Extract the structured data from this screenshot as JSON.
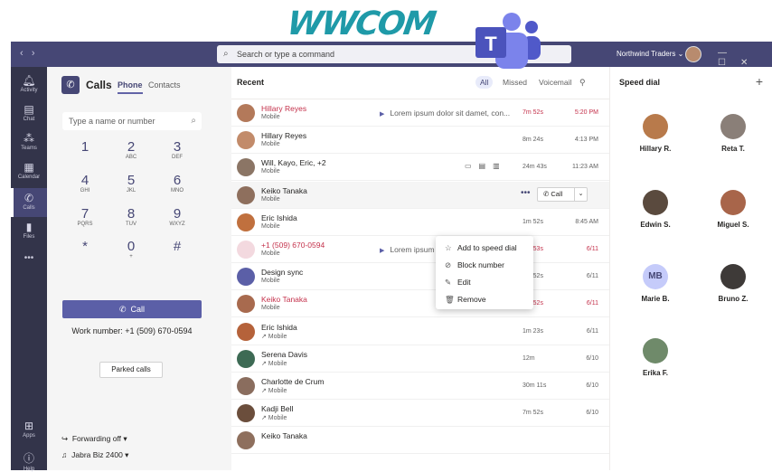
{
  "branding": {
    "wwcom": "WWCOM",
    "teams_letter": "T"
  },
  "titlebar": {
    "search_placeholder": "Search or type a command",
    "org": "Northwind Traders ⌄"
  },
  "rail": [
    {
      "label": "Activity",
      "icon": "bell-icon"
    },
    {
      "label": "Chat",
      "icon": "chat-icon"
    },
    {
      "label": "Teams",
      "icon": "teams-icon"
    },
    {
      "label": "Calendar",
      "icon": "calendar-icon"
    },
    {
      "label": "Calls",
      "icon": "phone-icon"
    },
    {
      "label": "Files",
      "icon": "file-icon"
    },
    {
      "label": "•••",
      "icon": "more-icon"
    },
    {
      "label": "Apps",
      "icon": "apps-icon"
    },
    {
      "label": "Help",
      "icon": "help-icon"
    }
  ],
  "calls": {
    "title": "Calls",
    "tabs": [
      "Phone",
      "Contacts"
    ],
    "number_placeholder": "Type a name or number",
    "keys": [
      {
        "d": "1",
        "l": ""
      },
      {
        "d": "2",
        "l": "ABC"
      },
      {
        "d": "3",
        "l": "DEF"
      },
      {
        "d": "4",
        "l": "GHI"
      },
      {
        "d": "5",
        "l": "JKL"
      },
      {
        "d": "6",
        "l": "MNO"
      },
      {
        "d": "7",
        "l": "PQRS"
      },
      {
        "d": "8",
        "l": "TUV"
      },
      {
        "d": "9",
        "l": "WXYZ"
      },
      {
        "d": "*",
        "l": ""
      },
      {
        "d": "0",
        "l": "+"
      },
      {
        "d": "#",
        "l": ""
      }
    ],
    "call_label": "Call",
    "work_number": "Work number: +1 (509) 670-0594",
    "parked": "Parked calls",
    "forwarding": "Forwarding off ▾",
    "device": "Jabra Biz 2400 ▾"
  },
  "recent": {
    "title": "Recent",
    "filters": [
      "All",
      "Missed",
      "Voicemail"
    ],
    "rows": [
      {
        "name": "Hillary Reyes",
        "type": "Mobile",
        "missed": true,
        "vm": "Lorem ipsum dolor sit damet, con...",
        "dur": "7m 52s",
        "time": "5:20 PM"
      },
      {
        "name": "Hillary Reyes",
        "type": "Mobile",
        "missed": false,
        "vm": "",
        "dur": "8m 24s",
        "time": "4:13 PM"
      },
      {
        "name": "Will, Kayo, Eric, +2",
        "type": "Mobile",
        "missed": false,
        "vm": "",
        "dur": "24m 43s",
        "time": "11:23 AM"
      },
      {
        "name": "Keiko Tanaka",
        "type": "Mobile",
        "missed": false,
        "vm": "",
        "dur": "",
        "time": ""
      },
      {
        "name": "Eric Ishida",
        "type": "Mobile",
        "missed": false,
        "vm": "",
        "dur": "1m 52s",
        "time": "8:45 AM"
      },
      {
        "name": "+1 (509) 670-0594",
        "type": "Mobile",
        "missed": true,
        "vm": "Lorem ipsum",
        "dur": "1m 53s",
        "time": "6/11"
      },
      {
        "name": "Design sync",
        "type": "Mobile",
        "missed": false,
        "vm": "",
        "dur": "1m 52s",
        "time": "6/11"
      },
      {
        "name": "Keiko Tanaka",
        "type": "Mobile",
        "missed": true,
        "vm": "",
        "dur": "7m 52s",
        "time": "6/11"
      },
      {
        "name": "Eric Ishida",
        "type": "↗ Mobile",
        "missed": false,
        "vm": "",
        "dur": "1m 23s",
        "time": "6/11"
      },
      {
        "name": "Serena Davis",
        "type": "↗ Mobile",
        "missed": false,
        "vm": "",
        "dur": "12m",
        "time": "6/10"
      },
      {
        "name": "Charlotte de Crum",
        "type": "↗ Mobile",
        "missed": false,
        "vm": "",
        "dur": "30m 11s",
        "time": "6/10"
      },
      {
        "name": "Kadji Bell",
        "type": "↗ Mobile",
        "missed": false,
        "vm": "",
        "dur": "7m 52s",
        "time": "6/10"
      },
      {
        "name": "Keiko Tanaka",
        "type": "",
        "missed": false,
        "vm": "",
        "dur": "",
        "time": ""
      }
    ],
    "row_call": "Call",
    "menu": [
      "Add to speed dial",
      "Block number",
      "Edit",
      "Remove"
    ]
  },
  "speed_dial": {
    "title": "Speed dial",
    "people": [
      {
        "name": "Hillary R.",
        "initials": "",
        "color": "#b87a4b"
      },
      {
        "name": "Reta T.",
        "initials": "",
        "color": "#8a7f78"
      },
      {
        "name": "Edwin S.",
        "initials": "",
        "color": "#5a4a3e"
      },
      {
        "name": "Miguel S.",
        "initials": "",
        "color": "#a8654a"
      },
      {
        "name": "Marie B.",
        "initials": "MB",
        "color": "#c5cbfa"
      },
      {
        "name": "Bruno Z.",
        "initials": "",
        "color": "#3e3a38"
      },
      {
        "name": "Erika F.",
        "initials": "",
        "color": "#6f8a6a"
      }
    ]
  },
  "colors": {
    "brand": "#464775",
    "accent": "#5b5fa7",
    "missed": "#c4314b",
    "logo": "#1f9aa8"
  }
}
